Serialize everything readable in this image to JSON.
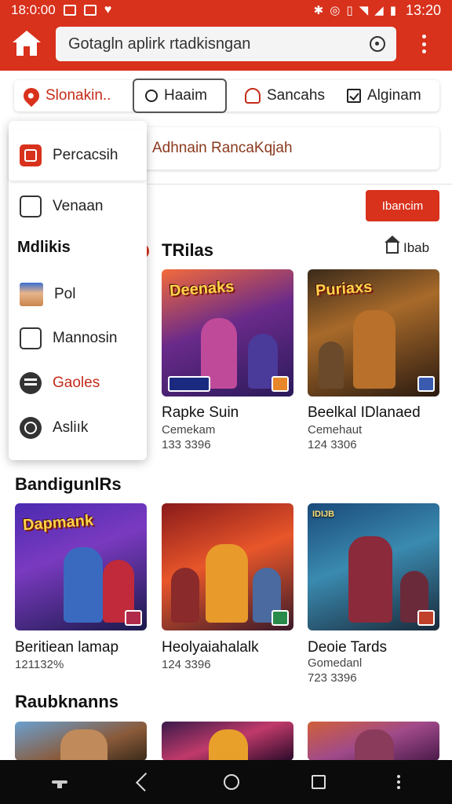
{
  "status_bar": {
    "time_left": "18:0:00",
    "time_right": "13:20"
  },
  "search": {
    "value": "Gotagln aplirk rtadkisngan"
  },
  "chips": [
    {
      "label": "Slonakin.."
    },
    {
      "label": "Haaim"
    },
    {
      "label": "Sancahs"
    },
    {
      "label": "Alginam"
    }
  ],
  "banner": {
    "text": "Adhnain RancaKqjah",
    "button_label": "Ibancim"
  },
  "dropdown": {
    "items": [
      {
        "label": "Percacsih",
        "icon": "red-square-icon"
      },
      {
        "label": "Venaan",
        "icon": "device-icon"
      }
    ],
    "section_header": "Mdlikis",
    "section_items": [
      {
        "label": "Pol",
        "icon": "avatar"
      },
      {
        "label": "Mannosin",
        "icon": "tablet-icon"
      },
      {
        "label": "Gaoles",
        "icon": "list-circle-icon"
      },
      {
        "label": "Asliık",
        "icon": "gear-icon"
      }
    ]
  },
  "trials": {
    "title": "TRilas",
    "link_label": "Ibab",
    "games": [
      {
        "name": "Rapke Suin",
        "sub": "Cemekam",
        "count": "133 3396",
        "art": "Deenaks"
      },
      {
        "name": "Beelkal IDlanaed",
        "sub": "Cemehaut",
        "count": "124 3306",
        "art": "Puriaxs"
      }
    ]
  },
  "bandiguns": {
    "title": "BandigunlRs",
    "games": [
      {
        "name": "Beritiean lamap",
        "count": "121132%",
        "art": "Dapmank"
      },
      {
        "name": "Heolyaiahalalk",
        "count": "124 3396",
        "art": ""
      },
      {
        "name": "Deoie Tards",
        "sub": "Gomedanl",
        "count": "723 3396",
        "art": "IDIJB"
      }
    ]
  },
  "raubknanns": {
    "title": "Raubknanns"
  },
  "colors": {
    "accent": "#d8311c",
    "nav_bg": "#0b0b0b"
  }
}
